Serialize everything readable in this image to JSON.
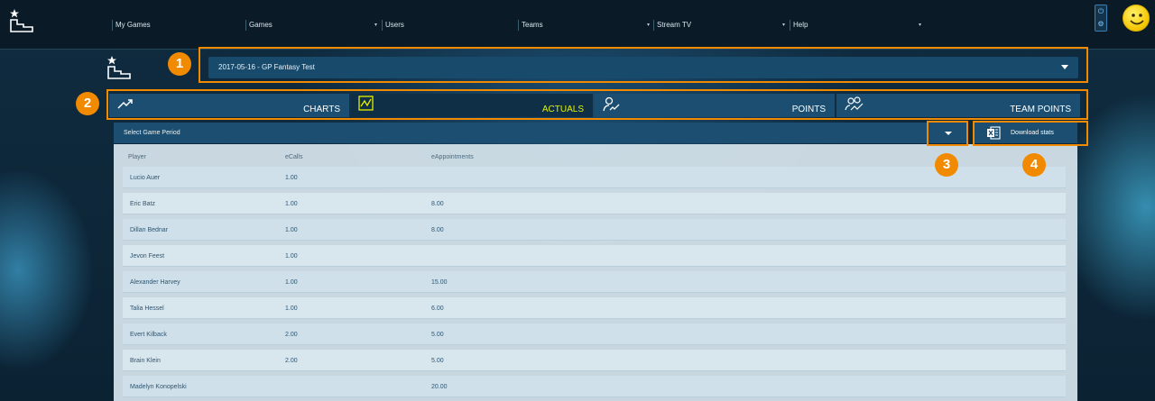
{
  "nav": {
    "items": [
      {
        "label": "My Games",
        "has_caret": false
      },
      {
        "label": "Games",
        "has_caret": true
      },
      {
        "label": "Users",
        "has_caret": false
      },
      {
        "label": "Teams",
        "has_caret": true
      },
      {
        "label": "Stream TV",
        "has_caret": true
      },
      {
        "label": "Help",
        "has_caret": true
      }
    ],
    "caret_glyph": "▾"
  },
  "game_selector": {
    "value": "2017-05-16 - GP Fantasy Test"
  },
  "tabs": [
    {
      "label": "CHARTS",
      "icon": "trend-up-icon",
      "active": false
    },
    {
      "label": "ACTUALS",
      "icon": "chart-square-icon",
      "active": true
    },
    {
      "label": "POINTS",
      "icon": "user-chart-icon",
      "active": false
    },
    {
      "label": "TEAM POINTS",
      "icon": "team-chart-icon",
      "active": false
    }
  ],
  "period": {
    "placeholder": "Select Game Period"
  },
  "download": {
    "label": "Download stats",
    "icon": "excel-icon"
  },
  "table": {
    "columns": [
      "Player",
      "eCalls",
      "eAppointments"
    ],
    "rows": [
      [
        "Lucio Auer",
        "1.00",
        ""
      ],
      [
        "Eric Batz",
        "1.00",
        "8.00"
      ],
      [
        "Dillan Bednar",
        "1.00",
        "8.00"
      ],
      [
        "Jevon Feest",
        "1.00",
        ""
      ],
      [
        "Alexander Harvey",
        "1.00",
        "15.00"
      ],
      [
        "Talia Hessel",
        "1.00",
        "6.00"
      ],
      [
        "Evert Kilback",
        "2.00",
        "5.00"
      ],
      [
        "Brain Klein",
        "2.00",
        "5.00"
      ],
      [
        "Madelyn Konopelski",
        "",
        "20.00"
      ]
    ]
  },
  "callouts": [
    "1",
    "2",
    "3",
    "4"
  ],
  "colors": {
    "accent": "#f28a00",
    "active_tab_label": "#e5f000",
    "header_blue": "#1b4e70"
  },
  "icons": {
    "logo": "podium-star-icon",
    "power": "power-icon",
    "settings": "gear-icon",
    "avatar": "smiley-avatar-icon"
  }
}
